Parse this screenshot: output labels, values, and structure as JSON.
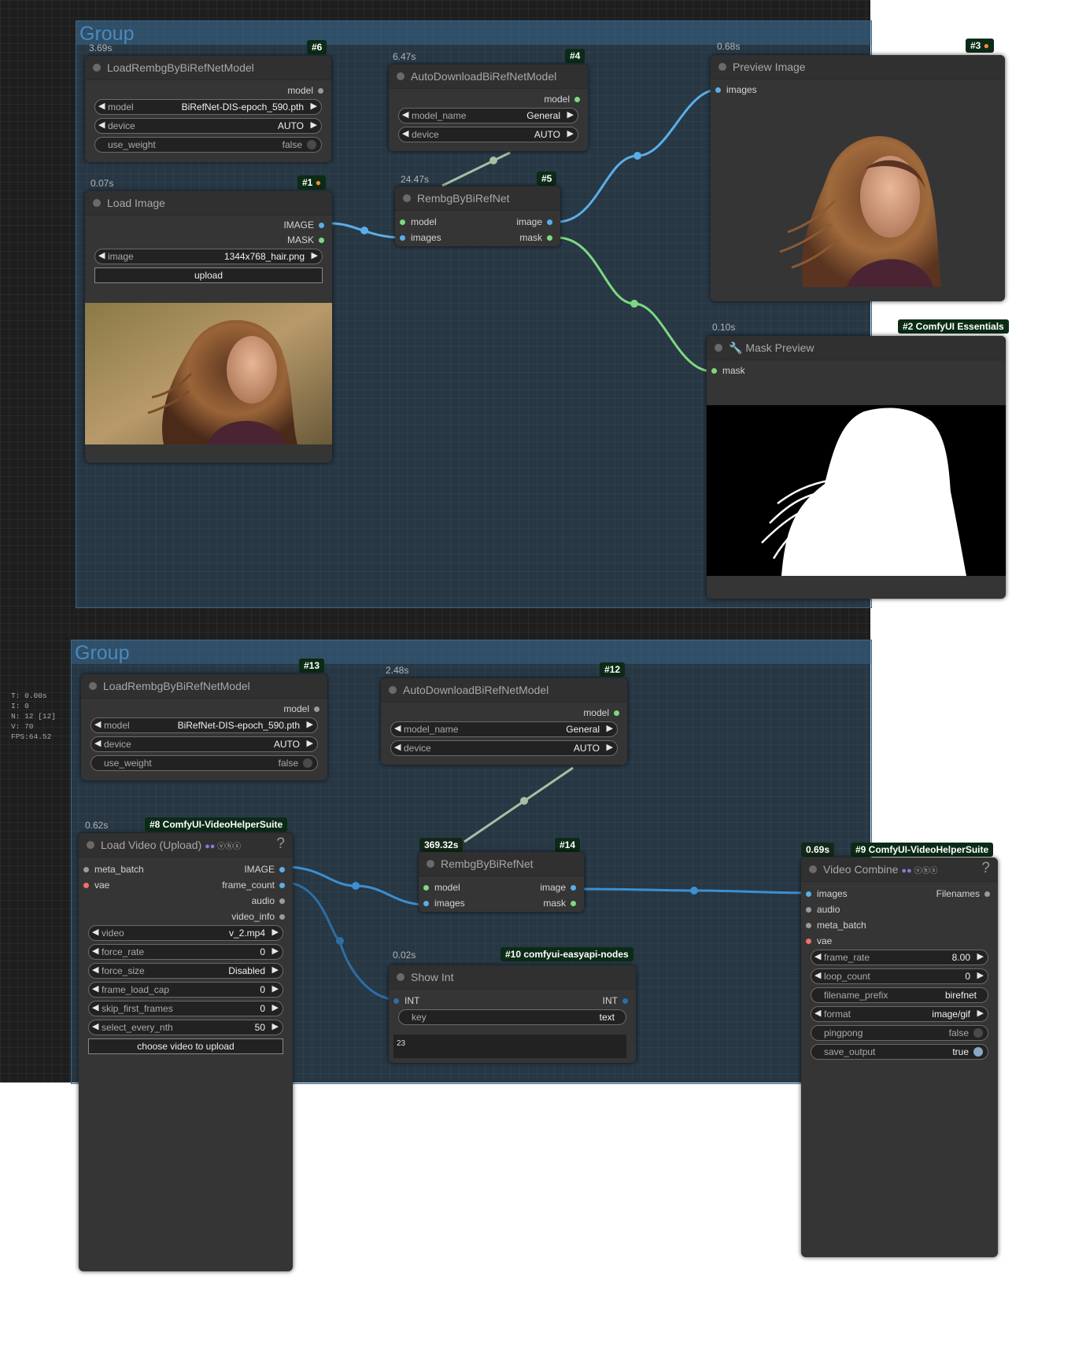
{
  "groups": [
    {
      "title": "Group"
    },
    {
      "title": "Group"
    }
  ],
  "stats": {
    "t": "T: 0.00s",
    "i": "I: 0",
    "n": "N: 12 [12]",
    "v": "V: 70",
    "fps": "FPS:64.52"
  },
  "nodes": {
    "n6": {
      "timing": "3.69s",
      "badge": "#6",
      "title": "LoadRembgByBiRefNetModel",
      "out_model": "model",
      "model_label": "model",
      "model_value": "BiRefNet-DIS-epoch_590.pth",
      "device_label": "device",
      "device_value": "AUTO",
      "uw_label": "use_weight",
      "uw_value": "false"
    },
    "n4": {
      "timing": "6.47s",
      "badge": "#4",
      "title": "AutoDownloadBiRefNetModel",
      "out_model": "model",
      "mn_label": "model_name",
      "mn_value": "General",
      "device_label": "device",
      "device_value": "AUTO"
    },
    "n3": {
      "timing": "0.68s",
      "badge": "#3",
      "title": "Preview Image",
      "in_images": "images"
    },
    "n1": {
      "timing": "0.07s",
      "badge": "#1",
      "title": "Load Image",
      "out_image": "IMAGE",
      "out_mask": "MASK",
      "image_label": "image",
      "image_value": "1344x768_hair.png",
      "upload": "upload"
    },
    "n5": {
      "timing": "24.47s",
      "badge": "#5",
      "title": "RembgByBiRefNet",
      "in_model": "model",
      "in_images": "images",
      "out_image": "image",
      "out_mask": "mask"
    },
    "n2": {
      "timing": "0.10s",
      "badge": "#2 ComfyUI Essentials",
      "title": "Mask Preview",
      "in_mask": "mask"
    },
    "n13": {
      "badge": "#13",
      "title": "LoadRembgByBiRefNetModel",
      "out_model": "model",
      "model_label": "model",
      "model_value": "BiRefNet-DIS-epoch_590.pth",
      "device_label": "device",
      "device_value": "AUTO",
      "uw_label": "use_weight",
      "uw_value": "false"
    },
    "n12": {
      "timing": "2.48s",
      "badge": "#12",
      "title": "AutoDownloadBiRefNetModel",
      "out_model": "model",
      "mn_label": "model_name",
      "mn_value": "General",
      "device_label": "device",
      "device_value": "AUTO"
    },
    "n8": {
      "timing": "0.62s",
      "badge": "#8 ComfyUI-VideoHelperSuite",
      "title": "Load Video (Upload)",
      "help": "?",
      "in_meta": "meta_batch",
      "in_vae": "vae",
      "out_image": "IMAGE",
      "out_fc": "frame_count",
      "out_audio": "audio",
      "out_vi": "video_info",
      "w": [
        {
          "l": "video",
          "v": "v_2.mp4"
        },
        {
          "l": "force_rate",
          "v": "0"
        },
        {
          "l": "force_size",
          "v": "Disabled"
        },
        {
          "l": "frame_load_cap",
          "v": "0"
        },
        {
          "l": "skip_first_frames",
          "v": "0"
        },
        {
          "l": "select_every_nth",
          "v": "50"
        }
      ],
      "choose": "choose video to upload"
    },
    "n14": {
      "timing": "369.32s",
      "badge": "#14",
      "title": "RembgByBiRefNet",
      "in_model": "model",
      "in_images": "images",
      "out_image": "image",
      "out_mask": "mask"
    },
    "n10": {
      "timing": "0.02s",
      "badge": "#10 comfyui-easyapi-nodes",
      "title": "Show Int",
      "in_int": "INT",
      "out_int": "INT",
      "key_label": "key",
      "key_value": "text",
      "display": "23"
    },
    "n9": {
      "timing": "0.69s",
      "badge": "#9 ComfyUI-VideoHelperSuite",
      "title": "Video Combine",
      "help": "?",
      "in_images": "images",
      "in_audio": "audio",
      "in_meta": "meta_batch",
      "in_vae": "vae",
      "out_fn": "Filenames",
      "fr_label": "frame_rate",
      "fr_value": "8.00",
      "lc_label": "loop_count",
      "lc_value": "0",
      "fp_label": "filename_prefix",
      "fp_value": "birefnet",
      "fmt_label": "format",
      "fmt_value": "image/gif",
      "pp_label": "pingpong",
      "pp_value": "false",
      "so_label": "save_output",
      "so_value": "true"
    }
  },
  "colors": {
    "image_link": "#5aaee8",
    "mask_link": "#7ed880",
    "model_link": "#a7bfa3"
  }
}
